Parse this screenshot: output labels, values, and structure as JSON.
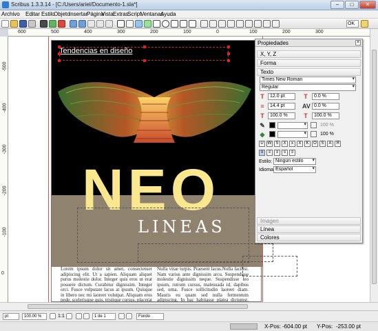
{
  "window": {
    "title": "Scribus 1.3.3.14 - [C:/Users/ariel/Documento-1.sla*]",
    "min_glyph": "–",
    "max_glyph": "□",
    "close_glyph": "✕"
  },
  "menu": {
    "items": [
      "Archivo",
      "Editar",
      "Estilo",
      "Objeto",
      "Insertar",
      "Página",
      "Vista",
      "Extras",
      "Script",
      "Ventanas",
      "Ayuda"
    ]
  },
  "toolbar": {
    "zoom_label": "PDF"
  },
  "rulers": {
    "h_labels": [
      "600",
      "500",
      "400",
      "300",
      "200",
      "100",
      "0",
      "100",
      "200",
      "300"
    ],
    "v_labels": [
      "-500",
      "-400",
      "-300",
      "-200",
      "-100",
      "0"
    ]
  },
  "document": {
    "heading": "Tendencias en diseño",
    "big_title": "NEO",
    "subtitle": "LINEAS",
    "body_col1": "Lorem ipsum dolor sit amet, consectetuer adipiscing elit. Ut a sapien. Aliquam aliquet purus molestie dolor. Integer quis eros ut erat posuere dictum. Curabitur dignissim. Integer orci. Fusce vulputate lacus at ipsum. Quisque in libero nec mi laoreet volutpat. Aliquam eros pede, scelerisque quis, tristique cursus, placerat convallis, velit.",
    "body_col2": "Nulla vitae turpis. Praesent lacus.Nulla facilisi. Nam varius ante dignissim arcu. Suspendisse molestie dignissim neque. Suspendisse leo ipsum, rutrum cursus, malesuada id, dapibus sed, urna. Fusce sollicitudin laoreet diam. Mauris eu quam sed nulla fermentum adipiscing. In hac habitasse platea dictumst. Morbi ut odio vitae eros luctus"
  },
  "properties": {
    "title": "Propiedades",
    "sections": {
      "xyz": "X, Y, Z",
      "forma": "Forma",
      "texto": "Texto",
      "imagen": "Imagen",
      "linea": "Línea",
      "colores": "Colores"
    },
    "font_name": "Times New Roman",
    "font_style": "Regular",
    "font_size": "12.0 pt",
    "tracking": "0.0 %",
    "line_spacing": "14.4 pt",
    "kerning": "0.0 %",
    "scale_w": "100.0 %",
    "scale_h": "100.0 %",
    "shade1": "100 %",
    "shade2": "100 %",
    "style_label": "Estilo:",
    "style_value": "Ningún estilo",
    "lang_label": "Idioma:",
    "lang_value": "Español",
    "effect_buttons": [
      "U",
      "W",
      "S",
      "X",
      "x",
      "X",
      "K",
      "O",
      "S",
      "A",
      "Я"
    ]
  },
  "statusbar": {
    "unit": "pt",
    "zoom": "100.00 %",
    "ratio": "1:1",
    "page": "1 de 1",
    "layer": "Fondo"
  },
  "coords": {
    "x_label": "X-Pos:",
    "x_value": "-604.00 pt",
    "y_label": "Y-Pos:",
    "y_value": "-253.00 pt"
  },
  "colors": {
    "heading": "#ffffff",
    "neo": "#fbe88e",
    "khaki": "#8f8370",
    "selection": "#d22222"
  }
}
